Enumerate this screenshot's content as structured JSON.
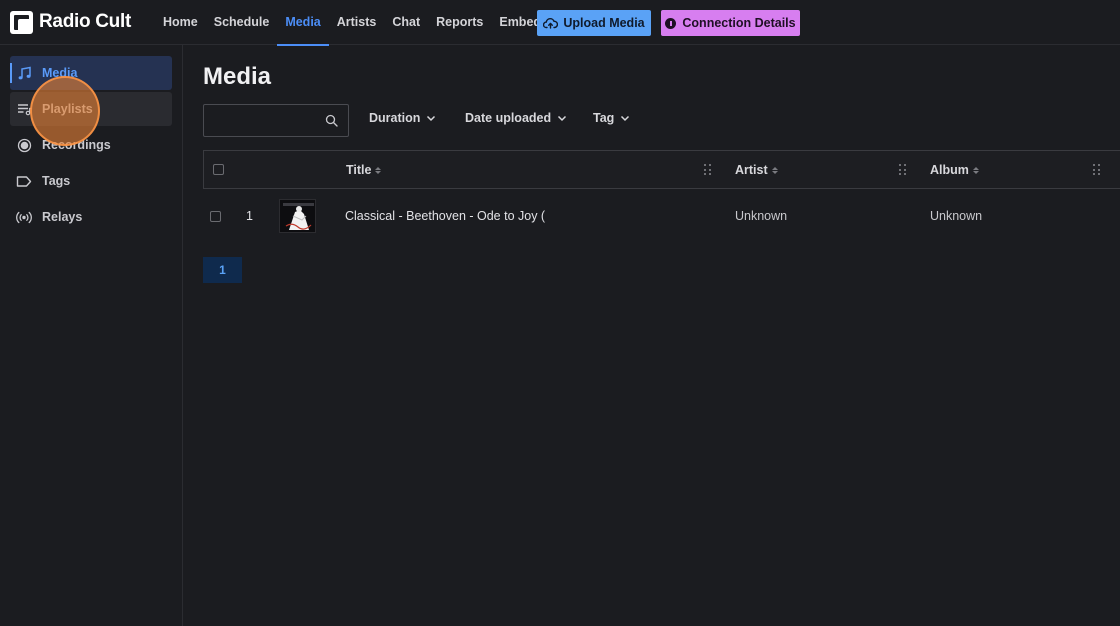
{
  "app": {
    "name": "Radio Cult"
  },
  "nav": {
    "items": [
      {
        "label": "Home"
      },
      {
        "label": "Schedule"
      },
      {
        "label": "Media",
        "active": true
      },
      {
        "label": "Artists"
      },
      {
        "label": "Chat"
      },
      {
        "label": "Reports"
      },
      {
        "label": "Embeds"
      }
    ],
    "upload_label": "Upload Media",
    "connection_label": "Connection Details"
  },
  "colors": {
    "accent": "#4c8ef7",
    "upload_button": "#5aa2f6",
    "connection_button": "#d77ef0",
    "background": "#1b1c20"
  },
  "sidebar": {
    "items": [
      {
        "label": "Media",
        "icon": "music-note-icon",
        "active": true
      },
      {
        "label": "Playlists",
        "icon": "playlist-icon"
      },
      {
        "label": "Recordings",
        "icon": "record-icon"
      },
      {
        "label": "Tags",
        "icon": "tag-icon"
      },
      {
        "label": "Relays",
        "icon": "broadcast-icon"
      }
    ]
  },
  "main": {
    "title": "Media",
    "search": {
      "value": "",
      "placeholder": ""
    },
    "filters": [
      "Duration",
      "Date uploaded",
      "Tag"
    ],
    "table": {
      "columns": [
        "Title",
        "Artist",
        "Album"
      ],
      "rows": [
        {
          "index": "1",
          "title": "Classical - Beethoven - Ode to Joy (",
          "artist": "Unknown",
          "album": "Unknown"
        }
      ]
    },
    "pagination": {
      "current_page": "1"
    }
  }
}
